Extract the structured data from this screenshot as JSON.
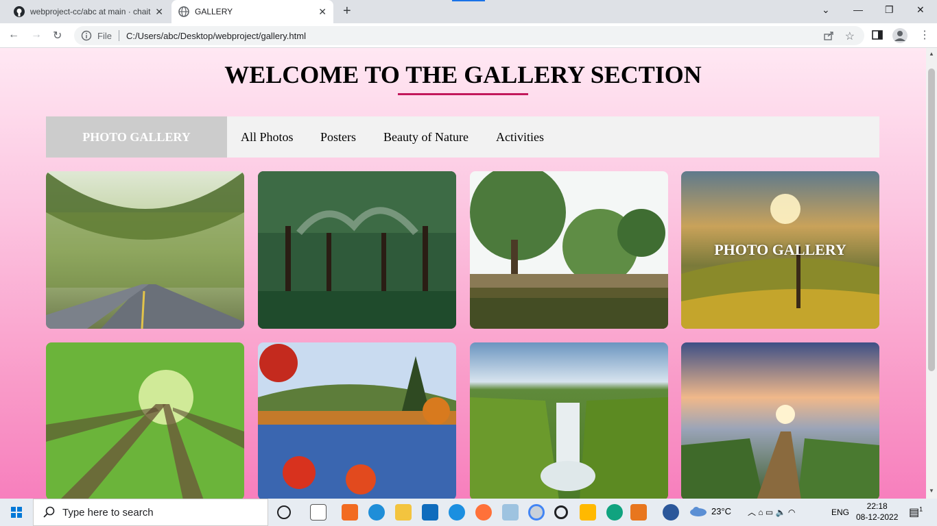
{
  "browser": {
    "tabs": [
      {
        "title": "webproject-cc/abc at main · chait",
        "active": false
      },
      {
        "title": "GALLERY",
        "active": true
      }
    ],
    "new_tab": "+",
    "window_controls": {
      "minimize": "—",
      "restore": "❐",
      "close": "✕",
      "dropdown": "⌄"
    },
    "nav": {
      "back": "←",
      "forward": "→",
      "reload": "↻"
    },
    "address": {
      "scheme_label": "File",
      "url": "C:/Users/abc/Desktop/webproject/gallery.html"
    },
    "star": "☆",
    "menu": "⋮"
  },
  "page": {
    "title": "WELCOME TO THE GALLERY SECTION",
    "accent_color": "#c2185b",
    "filter_bar": {
      "header": "PHOTO GALLERY",
      "items": [
        "All Photos",
        "Posters",
        "Beauty of Nature",
        "Activities"
      ]
    },
    "gallery": [
      {
        "name": "tree-lined-road-photo"
      },
      {
        "name": "tree-avenue-photo"
      },
      {
        "name": "lake-trees-photo"
      },
      {
        "name": "sunset-hill-photo",
        "overlay": "PHOTO GALLERY"
      },
      {
        "name": "forest-canopy-photo"
      },
      {
        "name": "autumn-lake-photo"
      },
      {
        "name": "waterfall-photo"
      },
      {
        "name": "sunrise-path-photo"
      }
    ]
  },
  "taskbar": {
    "search_placeholder": "Type here to search",
    "weather": "23°C",
    "language": "ENG",
    "time": "22:18",
    "date": "08-12-2022",
    "notification_count": "1"
  }
}
